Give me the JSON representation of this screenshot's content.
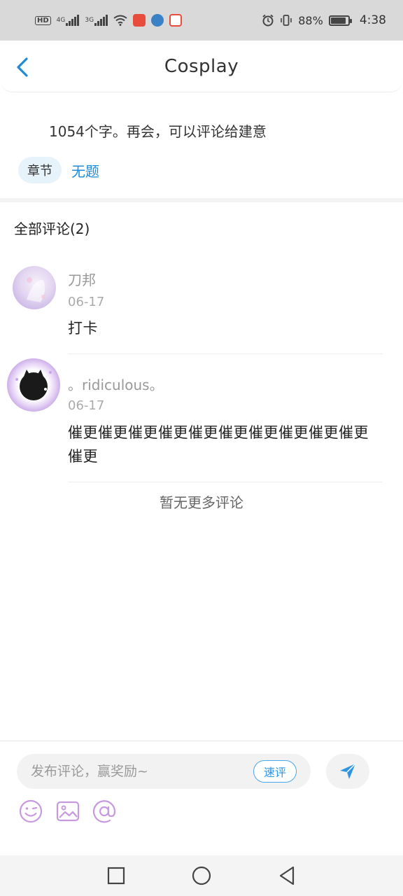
{
  "status_bar": {
    "left_icons": [
      "hd-icon",
      "4g-signal-icon",
      "3g-signal-icon",
      "wifi-icon",
      "app-notification-icon-1",
      "app-notification-icon-2",
      "app-notification-icon-3"
    ],
    "hd_label": "HD",
    "signal1_label": "4G",
    "signal2_label": "3G",
    "battery_percent": "88%",
    "time": "4:38"
  },
  "header": {
    "title": "Cosplay",
    "back_icon": "chevron-left-icon"
  },
  "chapter": {
    "text": "1054个字。再会，可以评论给建意",
    "badge": "章节",
    "link": "无题"
  },
  "comments": {
    "title": "全部评论(2)",
    "items": [
      {
        "name": "刀邦",
        "date": "06-17",
        "body": "打卡"
      },
      {
        "name": "。ridiculous。",
        "date": "06-17",
        "body": "催更催更催更催更催更催更催更催更催更催更催更"
      }
    ],
    "no_more": "暂无更多评论"
  },
  "input": {
    "placeholder": "发布评论，赢奖励~",
    "quick_label": "速评",
    "send_icon": "paper-plane-icon",
    "tools": [
      "emoji-icon",
      "image-icon",
      "mention-icon"
    ]
  },
  "nav": [
    "recent-apps-icon",
    "home-icon",
    "back-icon"
  ],
  "colors": {
    "accent": "#1e8bd8",
    "tool_icons": "#c79ae0",
    "badge_bg": "#e6f3fb"
  }
}
